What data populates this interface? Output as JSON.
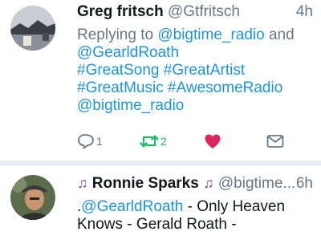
{
  "tweets": [
    {
      "author": "Greg fritsch",
      "handle": "@Gtfritsch",
      "time": "4h",
      "replying_prefix": "Replying to",
      "replying_user1": "@bigtime_radio",
      "replying_and": "and",
      "replying_user2": "@GearldRoath",
      "hashtags": [
        "#GreatSong",
        "#GreatArtist",
        "#GreatMusic",
        "#AwesomeRadio"
      ],
      "mention": "@bigtime_radio",
      "actions": {
        "replies": "1",
        "retweets": "2"
      },
      "avatar_icon": "lake-mountain-photo",
      "colors": {
        "retweet": "#17bf63",
        "like": "#e0245e"
      }
    },
    {
      "author_prefix_icon": "music-note-icon",
      "author": "Ronnie Sparks",
      "author_suffix_icon": "music-note-icon",
      "handle": "@bigtime...",
      "time": "6h",
      "text_dot": ".",
      "mention": "@GearldRoath",
      "text_rest": " - Only Heaven Knows - Gerald Roath -",
      "avatar_icon": "man-with-hat-photo"
    }
  ],
  "colors": {
    "link": "#1b95e0",
    "muted": "#657786",
    "text": "#14171a",
    "separator": "#e6ecf0"
  }
}
